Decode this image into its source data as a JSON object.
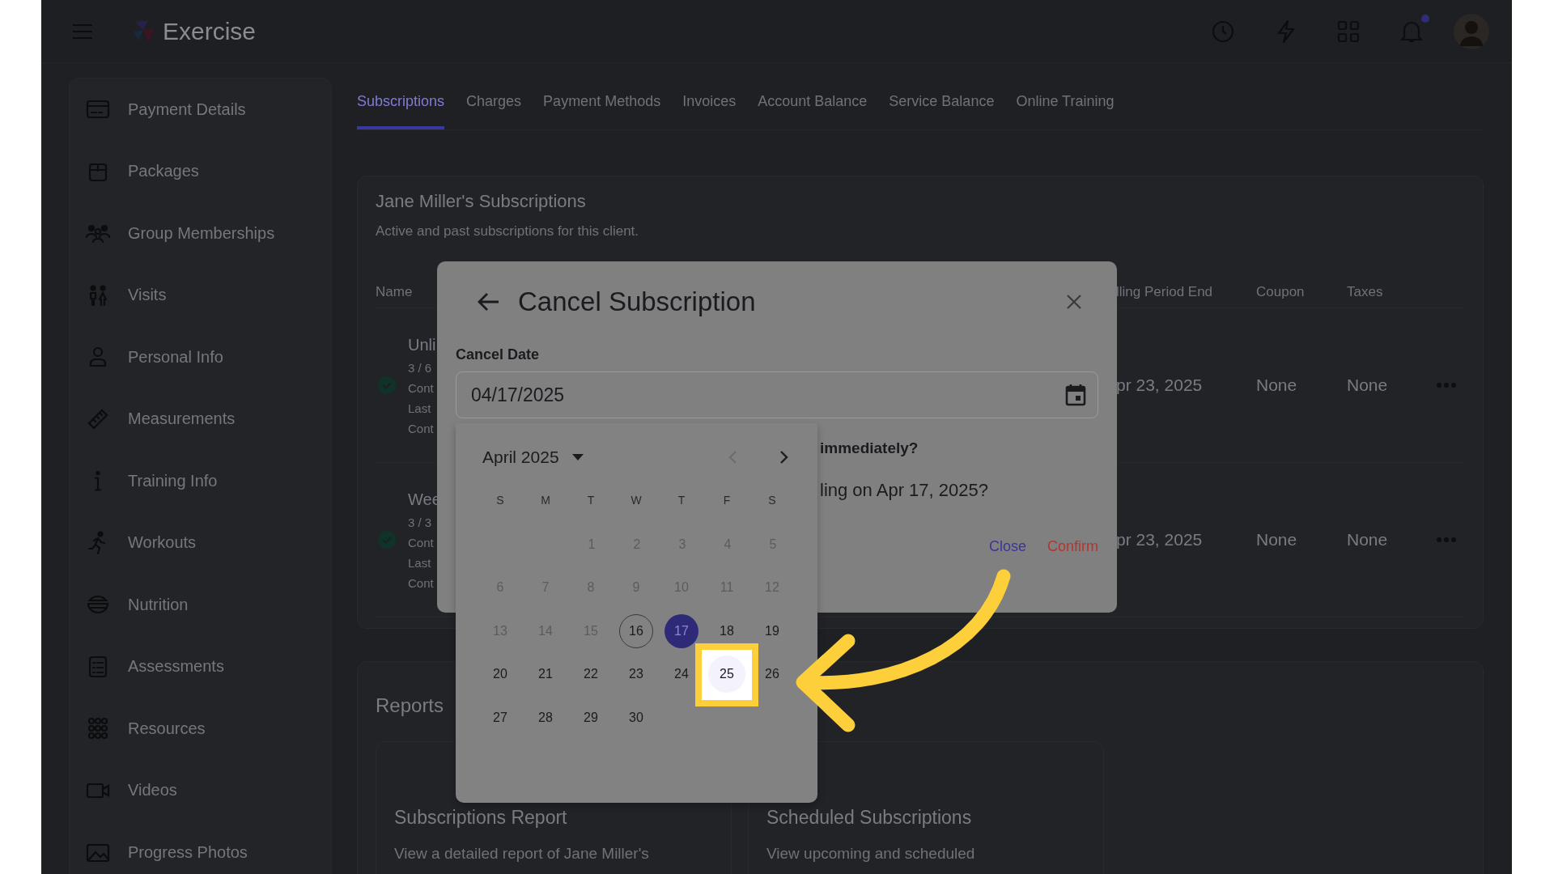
{
  "app": {
    "name": "Exercise"
  },
  "notifications": {
    "unread": true
  },
  "tabs": [
    {
      "label": "Subscriptions",
      "selected": true
    },
    {
      "label": "Charges",
      "selected": false
    },
    {
      "label": "Payment Methods",
      "selected": false
    },
    {
      "label": "Invoices",
      "selected": false
    },
    {
      "label": "Account Balance",
      "selected": false
    },
    {
      "label": "Service Balance",
      "selected": false
    },
    {
      "label": "Online Training",
      "selected": false
    }
  ],
  "sidebar": {
    "items": [
      {
        "label": "Payment Details"
      },
      {
        "label": "Packages"
      },
      {
        "label": "Group Memberships"
      },
      {
        "label": "Visits"
      },
      {
        "label": "Personal Info"
      },
      {
        "label": "Measurements"
      },
      {
        "label": "Training Info"
      },
      {
        "label": "Workouts"
      },
      {
        "label": "Nutrition"
      },
      {
        "label": "Assessments"
      },
      {
        "label": "Resources"
      },
      {
        "label": "Videos"
      },
      {
        "label": "Progress Photos"
      }
    ]
  },
  "subscriptions": {
    "title": "Jane Miller's Subscriptions",
    "subtitle": "Active and past subscriptions for this client.",
    "columns": [
      "Name",
      "lling Period End",
      "Coupon",
      "Taxes"
    ],
    "rows": [
      {
        "active": true,
        "lines": [
          "Unli",
          "3 / 6",
          "Cont",
          "Last",
          "Cont"
        ],
        "period_end": "pr 23, 2025",
        "coupon": "None",
        "taxes": "None"
      },
      {
        "active": true,
        "lines": [
          "Wee",
          "3 / 3",
          "Cont",
          "Last",
          "Cont"
        ],
        "period_end": "pr 23, 2025",
        "coupon": "None",
        "taxes": "None"
      }
    ]
  },
  "reports": {
    "title": "Reports",
    "cards": [
      {
        "title": "Subscriptions Report",
        "description": "View a detailed report of Jane Miller's"
      },
      {
        "title": "Scheduled Subscriptions",
        "description": "View upcoming and scheduled"
      }
    ]
  },
  "modal": {
    "title": "Cancel Subscription",
    "field_label": "Cancel Date",
    "field_value": "04/17/2025",
    "question_1": "immediately?",
    "question_2": "ling on Apr 17, 2025?",
    "buttons": [
      {
        "label": "Close",
        "kind": "secondary"
      },
      {
        "label": "Confirm",
        "kind": "danger"
      }
    ]
  },
  "date_picker": {
    "month": "April 2025",
    "prev_disabled": true,
    "weekdays": [
      "S",
      "M",
      "T",
      "W",
      "T",
      "F",
      "S"
    ],
    "weeks": [
      [
        {
          "label": "1",
          "disabled": true,
          "today": false,
          "selected": false,
          "highlighted": false
        },
        {
          "label": "2",
          "disabled": true,
          "today": false,
          "selected": false,
          "highlighted": false
        },
        {
          "label": "3",
          "disabled": true,
          "today": false,
          "selected": false,
          "highlighted": false
        },
        {
          "label": "4",
          "disabled": true,
          "today": false,
          "selected": false,
          "highlighted": false
        },
        {
          "label": "5",
          "disabled": true,
          "today": false,
          "selected": false,
          "highlighted": false
        }
      ],
      [
        {
          "label": "6",
          "disabled": true,
          "today": false,
          "selected": false,
          "highlighted": false
        },
        {
          "label": "7",
          "disabled": true,
          "today": false,
          "selected": false,
          "highlighted": false
        },
        {
          "label": "8",
          "disabled": true,
          "today": false,
          "selected": false,
          "highlighted": false
        },
        {
          "label": "9",
          "disabled": true,
          "today": false,
          "selected": false,
          "highlighted": false
        },
        {
          "label": "10",
          "disabled": true,
          "today": false,
          "selected": false,
          "highlighted": false
        },
        {
          "label": "11",
          "disabled": true,
          "today": false,
          "selected": false,
          "highlighted": false
        },
        {
          "label": "12",
          "disabled": true,
          "today": false,
          "selected": false,
          "highlighted": false
        }
      ],
      [
        {
          "label": "13",
          "disabled": true,
          "today": false,
          "selected": false,
          "highlighted": false
        },
        {
          "label": "14",
          "disabled": true,
          "today": false,
          "selected": false,
          "highlighted": false
        },
        {
          "label": "15",
          "disabled": true,
          "today": false,
          "selected": false,
          "highlighted": false
        },
        {
          "label": "16",
          "disabled": false,
          "today": true,
          "selected": false,
          "highlighted": false
        },
        {
          "label": "17",
          "disabled": false,
          "today": false,
          "selected": true,
          "highlighted": false
        },
        {
          "label": "18",
          "disabled": false,
          "today": false,
          "selected": false,
          "highlighted": false
        },
        {
          "label": "19",
          "disabled": false,
          "today": false,
          "selected": false,
          "highlighted": false
        }
      ],
      [
        {
          "label": "20",
          "disabled": false,
          "today": false,
          "selected": false,
          "highlighted": false
        },
        {
          "label": "21",
          "disabled": false,
          "today": false,
          "selected": false,
          "highlighted": false
        },
        {
          "label": "22",
          "disabled": false,
          "today": false,
          "selected": false,
          "highlighted": false
        },
        {
          "label": "23",
          "disabled": false,
          "today": false,
          "selected": false,
          "highlighted": false
        },
        {
          "label": "24",
          "disabled": false,
          "today": false,
          "selected": false,
          "highlighted": false
        },
        {
          "label": "25",
          "disabled": false,
          "today": false,
          "selected": false,
          "highlighted": true
        },
        {
          "label": "26",
          "disabled": false,
          "today": false,
          "selected": false,
          "highlighted": false
        }
      ],
      [
        {
          "label": "27",
          "disabled": false,
          "today": false,
          "selected": false,
          "highlighted": false
        },
        {
          "label": "28",
          "disabled": false,
          "today": false,
          "selected": false,
          "highlighted": false
        },
        {
          "label": "29",
          "disabled": false,
          "today": false,
          "selected": false,
          "highlighted": false
        },
        {
          "label": "30",
          "disabled": false,
          "today": false,
          "selected": false,
          "highlighted": false
        }
      ]
    ]
  }
}
